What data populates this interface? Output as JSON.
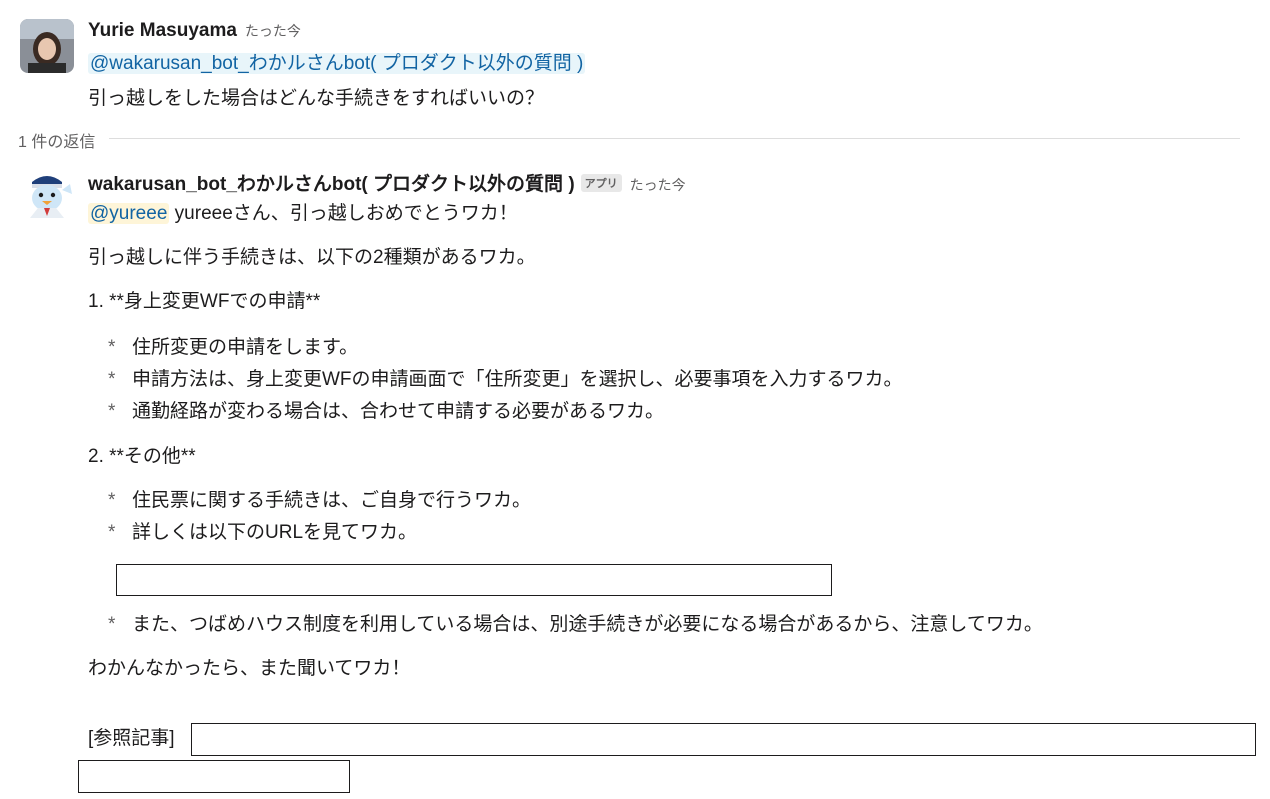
{
  "parent": {
    "author": "Yurie Masuyama",
    "time": "たった今",
    "mention": "@wakarusan_bot_わかルさんbot( プロダクト以外の質問 )",
    "text": "引っ越しをした場合はどんな手続きをすればいいの？"
  },
  "thread": {
    "reply_count_label": "1 件の返信"
  },
  "reply": {
    "author": "wakarusan_bot_わかルさんbot( プロダクト以外の質問 )",
    "badge": "アプリ",
    "time": "たった今",
    "mention": "@yureee",
    "greeting": " yureeeさん、引っ越しおめでとうワカ！",
    "intro": "引っ越しに伴う手続きは、以下の2種類があるワカ。",
    "section1_title": "1. **身上変更WFでの申請**",
    "section1_items": [
      "住所変更の申請をします。",
      "申請方法は、身上変更WFの申請画面で「住所変更」を選択し、必要事項を入力するワカ。",
      "通勤経路が変わる場合は、合わせて申請する必要があるワカ。"
    ],
    "section2_title": "2. **その他**",
    "section2_items": [
      "住民票に関する手続きは、ご自身で行うワカ。",
      "詳しくは以下のURLを見てワカ。",
      "また、つばめハウス制度を利用している場合は、別途手続きが必要になる場合があるから、注意してワカ。"
    ],
    "bullet_mark": "*",
    "closing": "わかんなかったら、また聞いてワカ！",
    "ref_label": "[参照記事]"
  }
}
